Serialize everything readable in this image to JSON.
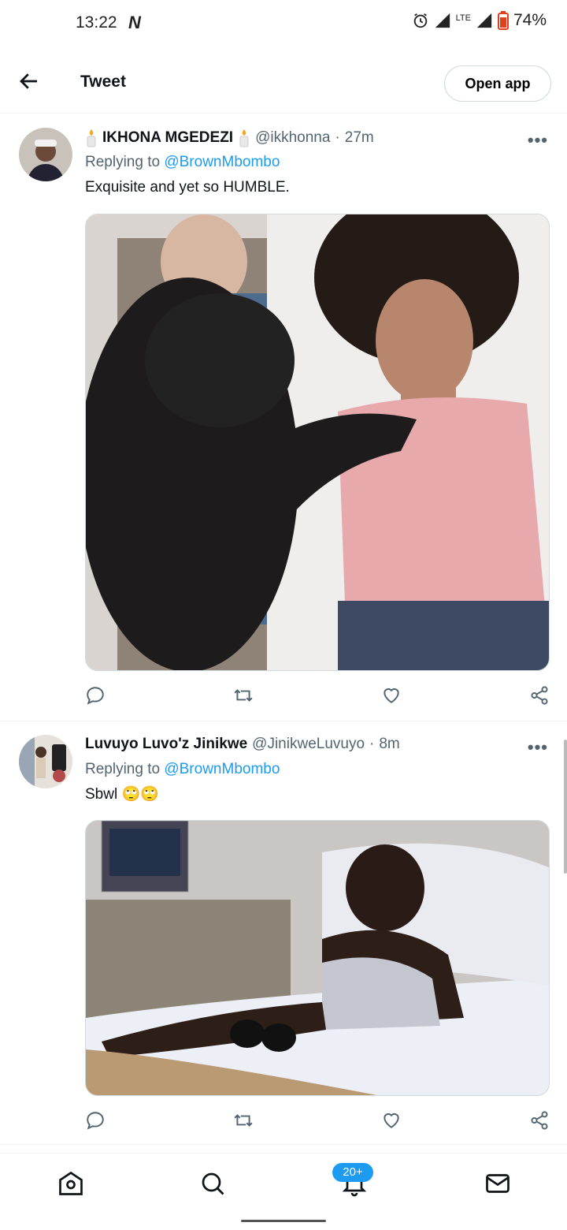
{
  "status": {
    "time": "13:22",
    "carrier_icon": "N",
    "network": "LTE",
    "battery": "74%"
  },
  "header": {
    "title": "Tweet",
    "open_app_label": "Open app"
  },
  "tweets": [
    {
      "name": "IKHONA MGEDEZI",
      "handle": "@ikkhonna",
      "separator": "·",
      "time": "27m",
      "replying_prefix": "Replying to",
      "replying_to": "@BrownMbombo",
      "text": "Exquisite and yet so HUMBLE.",
      "name_icons": [
        "candle-icon",
        "candle-icon"
      ]
    },
    {
      "name": "Luvuyo Luvo'z Jinikwe",
      "handle": "@JinikweLuvuyo",
      "separator": "·",
      "time": "8m",
      "replying_prefix": "Replying to",
      "replying_to": "@BrownMbombo",
      "text": "Sbwl",
      "emoji": "🙄🙄"
    }
  ],
  "nav": {
    "notifications_badge": "20+"
  },
  "colors": {
    "accent": "#1d9bf0",
    "secondary_text": "#536471",
    "border": "#eff3f4"
  }
}
